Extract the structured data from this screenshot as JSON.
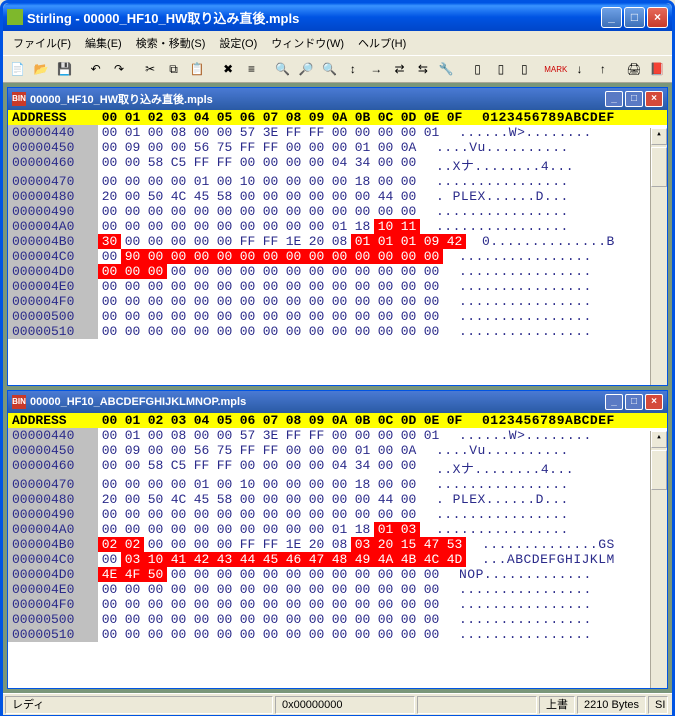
{
  "window": {
    "title": "Stirling - 00000_HF10_HW取り込み直後.mpls"
  },
  "menu": {
    "file": "ファイル(F)",
    "edit": "編集(E)",
    "search": "検索・移動(S)",
    "settings": "設定(O)",
    "window": "ウィンドウ(W)",
    "help": "ヘルプ(H)"
  },
  "winbtns": {
    "min": "_",
    "max": "□",
    "close": "×"
  },
  "mdi1": {
    "title": "00000_HF10_HW取り込み直後.mpls",
    "header": {
      "addr": "ADDRESS",
      "cols": [
        "00",
        "01",
        "02",
        "03",
        "04",
        "05",
        "06",
        "07",
        "08",
        "09",
        "0A",
        "0B",
        "0C",
        "0D",
        "0E",
        "0F"
      ],
      "asc": "0123456789ABCDEF"
    },
    "rows": [
      {
        "addr": "00000440",
        "b": [
          "00",
          "01",
          "00",
          "08",
          "00",
          "00",
          "57",
          "3E",
          "FF",
          "FF",
          "00",
          "00",
          "00",
          "00",
          "01"
        ],
        "hl": [],
        "asc": "......W>........"
      },
      {
        "addr": "00000450",
        "b": [
          "00",
          "09",
          "00",
          "00",
          "56",
          "75",
          "FF",
          "FF",
          "00",
          "00",
          "00",
          "01",
          "00",
          "0A"
        ],
        "hl": [],
        "asc": "....Vu.........."
      },
      {
        "addr": "00000460",
        "b": [
          "00",
          "00",
          "58",
          "C5",
          "FF",
          "FF",
          "00",
          "00",
          "00",
          "00",
          "04",
          "34",
          "00",
          "00"
        ],
        "hl": [],
        "asc": "..Xナ........4..."
      },
      {
        "addr": "00000470",
        "b": [
          "00",
          "00",
          "00",
          "00",
          "01",
          "00",
          "10",
          "00",
          "00",
          "00",
          "00",
          "18",
          "00",
          "00"
        ],
        "hl": [],
        "asc": "................"
      },
      {
        "addr": "00000480",
        "b": [
          "20",
          "00",
          "50",
          "4C",
          "45",
          "58",
          "00",
          "00",
          "00",
          "00",
          "00",
          "00",
          "44",
          "00"
        ],
        "hl": [],
        "asc": ". PLEX......D..."
      },
      {
        "addr": "00000490",
        "b": [
          "00",
          "00",
          "00",
          "00",
          "00",
          "00",
          "00",
          "00",
          "00",
          "00",
          "00",
          "00",
          "00",
          "00"
        ],
        "hl": [],
        "asc": "................"
      },
      {
        "addr": "000004A0",
        "b": [
          "00",
          "00",
          "00",
          "00",
          "00",
          "00",
          "00",
          "00",
          "00",
          "00",
          "01",
          "18",
          "10",
          "11"
        ],
        "hl": [
          12,
          13
        ],
        "asc": "................"
      },
      {
        "addr": "000004B0",
        "b": [
          "30",
          "00",
          "00",
          "00",
          "00",
          "00",
          "FF",
          "FF",
          "1E",
          "20",
          "08",
          "01",
          "01",
          "01",
          "09",
          "42"
        ],
        "hl": [
          0,
          11,
          12,
          13,
          14,
          15
        ],
        "asc": "0..............B"
      },
      {
        "addr": "000004C0",
        "b": [
          "00",
          "90",
          "00",
          "00",
          "00",
          "00",
          "00",
          "00",
          "00",
          "00",
          "00",
          "00",
          "00",
          "00",
          "00"
        ],
        "hl": [
          1,
          2,
          3,
          4,
          5,
          6,
          7,
          8,
          9,
          10,
          11,
          12,
          13,
          14
        ],
        "asc": "................"
      },
      {
        "addr": "000004D0",
        "b": [
          "00",
          "00",
          "00",
          "00",
          "00",
          "00",
          "00",
          "00",
          "00",
          "00",
          "00",
          "00",
          "00",
          "00",
          "00"
        ],
        "hl": [
          0,
          1,
          2
        ],
        "asc": "................"
      },
      {
        "addr": "000004E0",
        "b": [
          "00",
          "00",
          "00",
          "00",
          "00",
          "00",
          "00",
          "00",
          "00",
          "00",
          "00",
          "00",
          "00",
          "00",
          "00"
        ],
        "hl": [],
        "asc": "................"
      },
      {
        "addr": "000004F0",
        "b": [
          "00",
          "00",
          "00",
          "00",
          "00",
          "00",
          "00",
          "00",
          "00",
          "00",
          "00",
          "00",
          "00",
          "00",
          "00"
        ],
        "hl": [],
        "asc": "................"
      },
      {
        "addr": "00000500",
        "b": [
          "00",
          "00",
          "00",
          "00",
          "00",
          "00",
          "00",
          "00",
          "00",
          "00",
          "00",
          "00",
          "00",
          "00",
          "00"
        ],
        "hl": [],
        "asc": "................"
      },
      {
        "addr": "00000510",
        "b": [
          "00",
          "00",
          "00",
          "00",
          "00",
          "00",
          "00",
          "00",
          "00",
          "00",
          "00",
          "00",
          "00",
          "00",
          "00"
        ],
        "hl": [],
        "asc": "................"
      }
    ]
  },
  "mdi2": {
    "title": "00000_HF10_ABCDEFGHIJKLMNOP.mpls",
    "header": {
      "addr": "ADDRESS",
      "cols": [
        "00",
        "01",
        "02",
        "03",
        "04",
        "05",
        "06",
        "07",
        "08",
        "09",
        "0A",
        "0B",
        "0C",
        "0D",
        "0E",
        "0F"
      ],
      "asc": "0123456789ABCDEF"
    },
    "rows": [
      {
        "addr": "00000440",
        "b": [
          "00",
          "01",
          "00",
          "08",
          "00",
          "00",
          "57",
          "3E",
          "FF",
          "FF",
          "00",
          "00",
          "00",
          "00",
          "01"
        ],
        "hl": [],
        "asc": "......W>........"
      },
      {
        "addr": "00000450",
        "b": [
          "00",
          "09",
          "00",
          "00",
          "56",
          "75",
          "FF",
          "FF",
          "00",
          "00",
          "00",
          "01",
          "00",
          "0A"
        ],
        "hl": [],
        "asc": "....Vu.........."
      },
      {
        "addr": "00000460",
        "b": [
          "00",
          "00",
          "58",
          "C5",
          "FF",
          "FF",
          "00",
          "00",
          "00",
          "00",
          "04",
          "34",
          "00",
          "00"
        ],
        "hl": [],
        "asc": "..Xナ........4..."
      },
      {
        "addr": "00000470",
        "b": [
          "00",
          "00",
          "00",
          "00",
          "01",
          "00",
          "10",
          "00",
          "00",
          "00",
          "00",
          "18",
          "00",
          "00"
        ],
        "hl": [],
        "asc": "................"
      },
      {
        "addr": "00000480",
        "b": [
          "20",
          "00",
          "50",
          "4C",
          "45",
          "58",
          "00",
          "00",
          "00",
          "00",
          "00",
          "00",
          "44",
          "00"
        ],
        "hl": [],
        "asc": ". PLEX......D..."
      },
      {
        "addr": "00000490",
        "b": [
          "00",
          "00",
          "00",
          "00",
          "00",
          "00",
          "00",
          "00",
          "00",
          "00",
          "00",
          "00",
          "00",
          "00"
        ],
        "hl": [],
        "asc": "................"
      },
      {
        "addr": "000004A0",
        "b": [
          "00",
          "00",
          "00",
          "00",
          "00",
          "00",
          "00",
          "00",
          "00",
          "00",
          "01",
          "18",
          "01",
          "03"
        ],
        "hl": [
          12,
          13
        ],
        "asc": "................"
      },
      {
        "addr": "000004B0",
        "b": [
          "02",
          "02",
          "00",
          "00",
          "00",
          "00",
          "FF",
          "FF",
          "1E",
          "20",
          "08",
          "03",
          "20",
          "15",
          "47",
          "53"
        ],
        "hl": [
          0,
          1,
          11,
          12,
          13,
          14,
          15
        ],
        "asc": "..............GS"
      },
      {
        "addr": "000004C0",
        "b": [
          "00",
          "03",
          "10",
          "41",
          "42",
          "43",
          "44",
          "45",
          "46",
          "47",
          "48",
          "49",
          "4A",
          "4B",
          "4C",
          "4D"
        ],
        "hl": [
          1,
          2,
          3,
          4,
          5,
          6,
          7,
          8,
          9,
          10,
          11,
          12,
          13,
          14,
          15
        ],
        "asc": "...ABCDEFGHIJKLM"
      },
      {
        "addr": "000004D0",
        "b": [
          "4E",
          "4F",
          "50",
          "00",
          "00",
          "00",
          "00",
          "00",
          "00",
          "00",
          "00",
          "00",
          "00",
          "00",
          "00"
        ],
        "hl": [
          0,
          1,
          2
        ],
        "asc": "NOP............."
      },
      {
        "addr": "000004E0",
        "b": [
          "00",
          "00",
          "00",
          "00",
          "00",
          "00",
          "00",
          "00",
          "00",
          "00",
          "00",
          "00",
          "00",
          "00",
          "00"
        ],
        "hl": [],
        "asc": "................"
      },
      {
        "addr": "000004F0",
        "b": [
          "00",
          "00",
          "00",
          "00",
          "00",
          "00",
          "00",
          "00",
          "00",
          "00",
          "00",
          "00",
          "00",
          "00",
          "00"
        ],
        "hl": [],
        "asc": "................"
      },
      {
        "addr": "00000500",
        "b": [
          "00",
          "00",
          "00",
          "00",
          "00",
          "00",
          "00",
          "00",
          "00",
          "00",
          "00",
          "00",
          "00",
          "00",
          "00"
        ],
        "hl": [],
        "asc": "................"
      },
      {
        "addr": "00000510",
        "b": [
          "00",
          "00",
          "00",
          "00",
          "00",
          "00",
          "00",
          "00",
          "00",
          "00",
          "00",
          "00",
          "00",
          "00",
          "00"
        ],
        "hl": [],
        "asc": "................"
      }
    ]
  },
  "status": {
    "ready": "レディ",
    "pos": "0x00000000",
    "mode": "上書",
    "size": "2210 Bytes",
    "end": "SI"
  }
}
